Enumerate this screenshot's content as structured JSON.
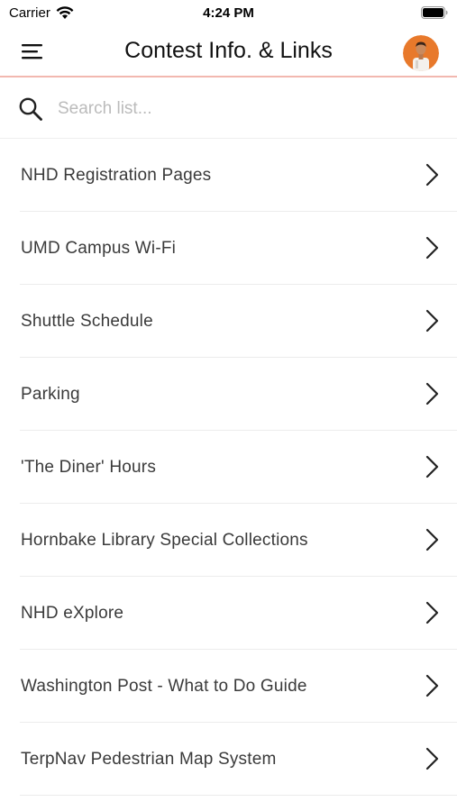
{
  "status_bar": {
    "carrier": "Carrier",
    "time": "4:24 PM",
    "icons": [
      "wifi-icon",
      "battery-icon"
    ]
  },
  "nav": {
    "title": "Contest Info. & Links",
    "menu_icon": "menu-icon",
    "avatar_icon": "user-avatar"
  },
  "search": {
    "placeholder": "Search list...",
    "value": ""
  },
  "list": {
    "items": [
      {
        "label": "NHD Registration Pages"
      },
      {
        "label": "UMD Campus Wi-Fi"
      },
      {
        "label": "Shuttle Schedule"
      },
      {
        "label": "Parking"
      },
      {
        "label": "'The Diner' Hours"
      },
      {
        "label": "Hornbake Library Special Collections"
      },
      {
        "label": "NHD eXplore"
      },
      {
        "label": "Washington Post - What to Do Guide"
      },
      {
        "label": "TerpNav Pedestrian Map System"
      }
    ]
  },
  "colors": {
    "nav_border": "#f2b8b0",
    "avatar_bg": "#e8792b",
    "text": "#3a3a3a"
  }
}
